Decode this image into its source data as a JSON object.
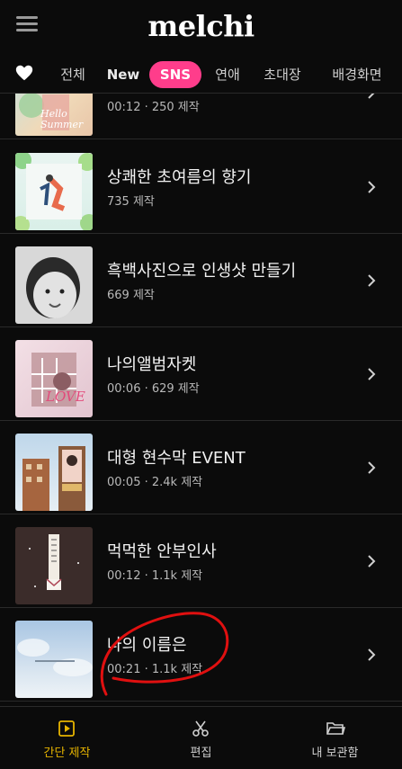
{
  "header": {
    "logo": "melchi",
    "menu_icon": "menu-icon"
  },
  "tabs": [
    {
      "label": "전체"
    },
    {
      "label": "New"
    },
    {
      "label": "SNS"
    },
    {
      "label": "연애"
    },
    {
      "label": "초대장"
    },
    {
      "label": "배경화면"
    }
  ],
  "list": [
    {
      "title": "",
      "meta": "00:12  ·  250 제작"
    },
    {
      "title": "상쾌한 초여름의 향기",
      "meta": "735 제작"
    },
    {
      "title": "흑백사진으로 인생샷 만들기",
      "meta": "669 제작"
    },
    {
      "title": "나의앨범자켓",
      "meta": "00:06  ·  629 제작"
    },
    {
      "title": "대형 현수막 EVENT",
      "meta": "00:05  ·  2.4k 제작"
    },
    {
      "title": "먹먹한 안부인사",
      "meta": "00:12  ·  1.1k 제작"
    },
    {
      "title": "나의 이름은",
      "meta": "00:21  ·  1.1k 제작"
    }
  ],
  "thumb_text": {
    "summer": "Hello Summer",
    "love": "LOVE"
  },
  "bottom_nav": [
    {
      "label": "간단 제작"
    },
    {
      "label": "편집"
    },
    {
      "label": "내 보관함"
    }
  ],
  "colors": {
    "accent_pink": "#ff3d8b",
    "active_nav": "#e6b400",
    "annotation": "#e01010"
  }
}
